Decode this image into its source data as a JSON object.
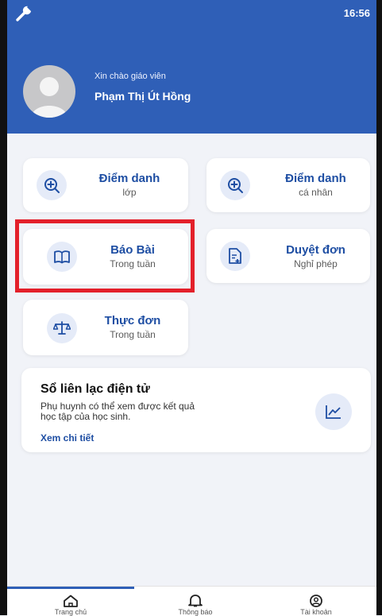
{
  "status": {
    "time": "16:56"
  },
  "header": {
    "greeting": "Xin chào giáo viên",
    "teacher_name": "Phạm Thị Út Hồng"
  },
  "menu": [
    {
      "title": "Điểm danh",
      "subtitle": "lớp",
      "icon": "zoom-in-icon"
    },
    {
      "title": "Điểm danh",
      "subtitle": "cá nhân",
      "icon": "zoom-in-icon"
    },
    {
      "title": "Báo Bài",
      "subtitle": "Trong tuần",
      "icon": "book-icon"
    },
    {
      "title": "Duyệt đơn",
      "subtitle": "Nghỉ phép",
      "icon": "document-add-icon"
    },
    {
      "title": "Thực đơn",
      "subtitle": "Trong tuần",
      "icon": "scale-icon"
    }
  ],
  "contact_book": {
    "title": "Sổ liên lạc điện tử",
    "description": "Phụ huynh có thể xem được kết quả học tập của học sinh.",
    "link": "Xem chi tiết",
    "icon": "line-chart-icon"
  },
  "nav": {
    "home": "Trang chủ",
    "notifications": "Thông báo",
    "account": "Tài khoản"
  },
  "colors": {
    "primary": "#2f5fb7",
    "highlight": "#e3202a"
  }
}
